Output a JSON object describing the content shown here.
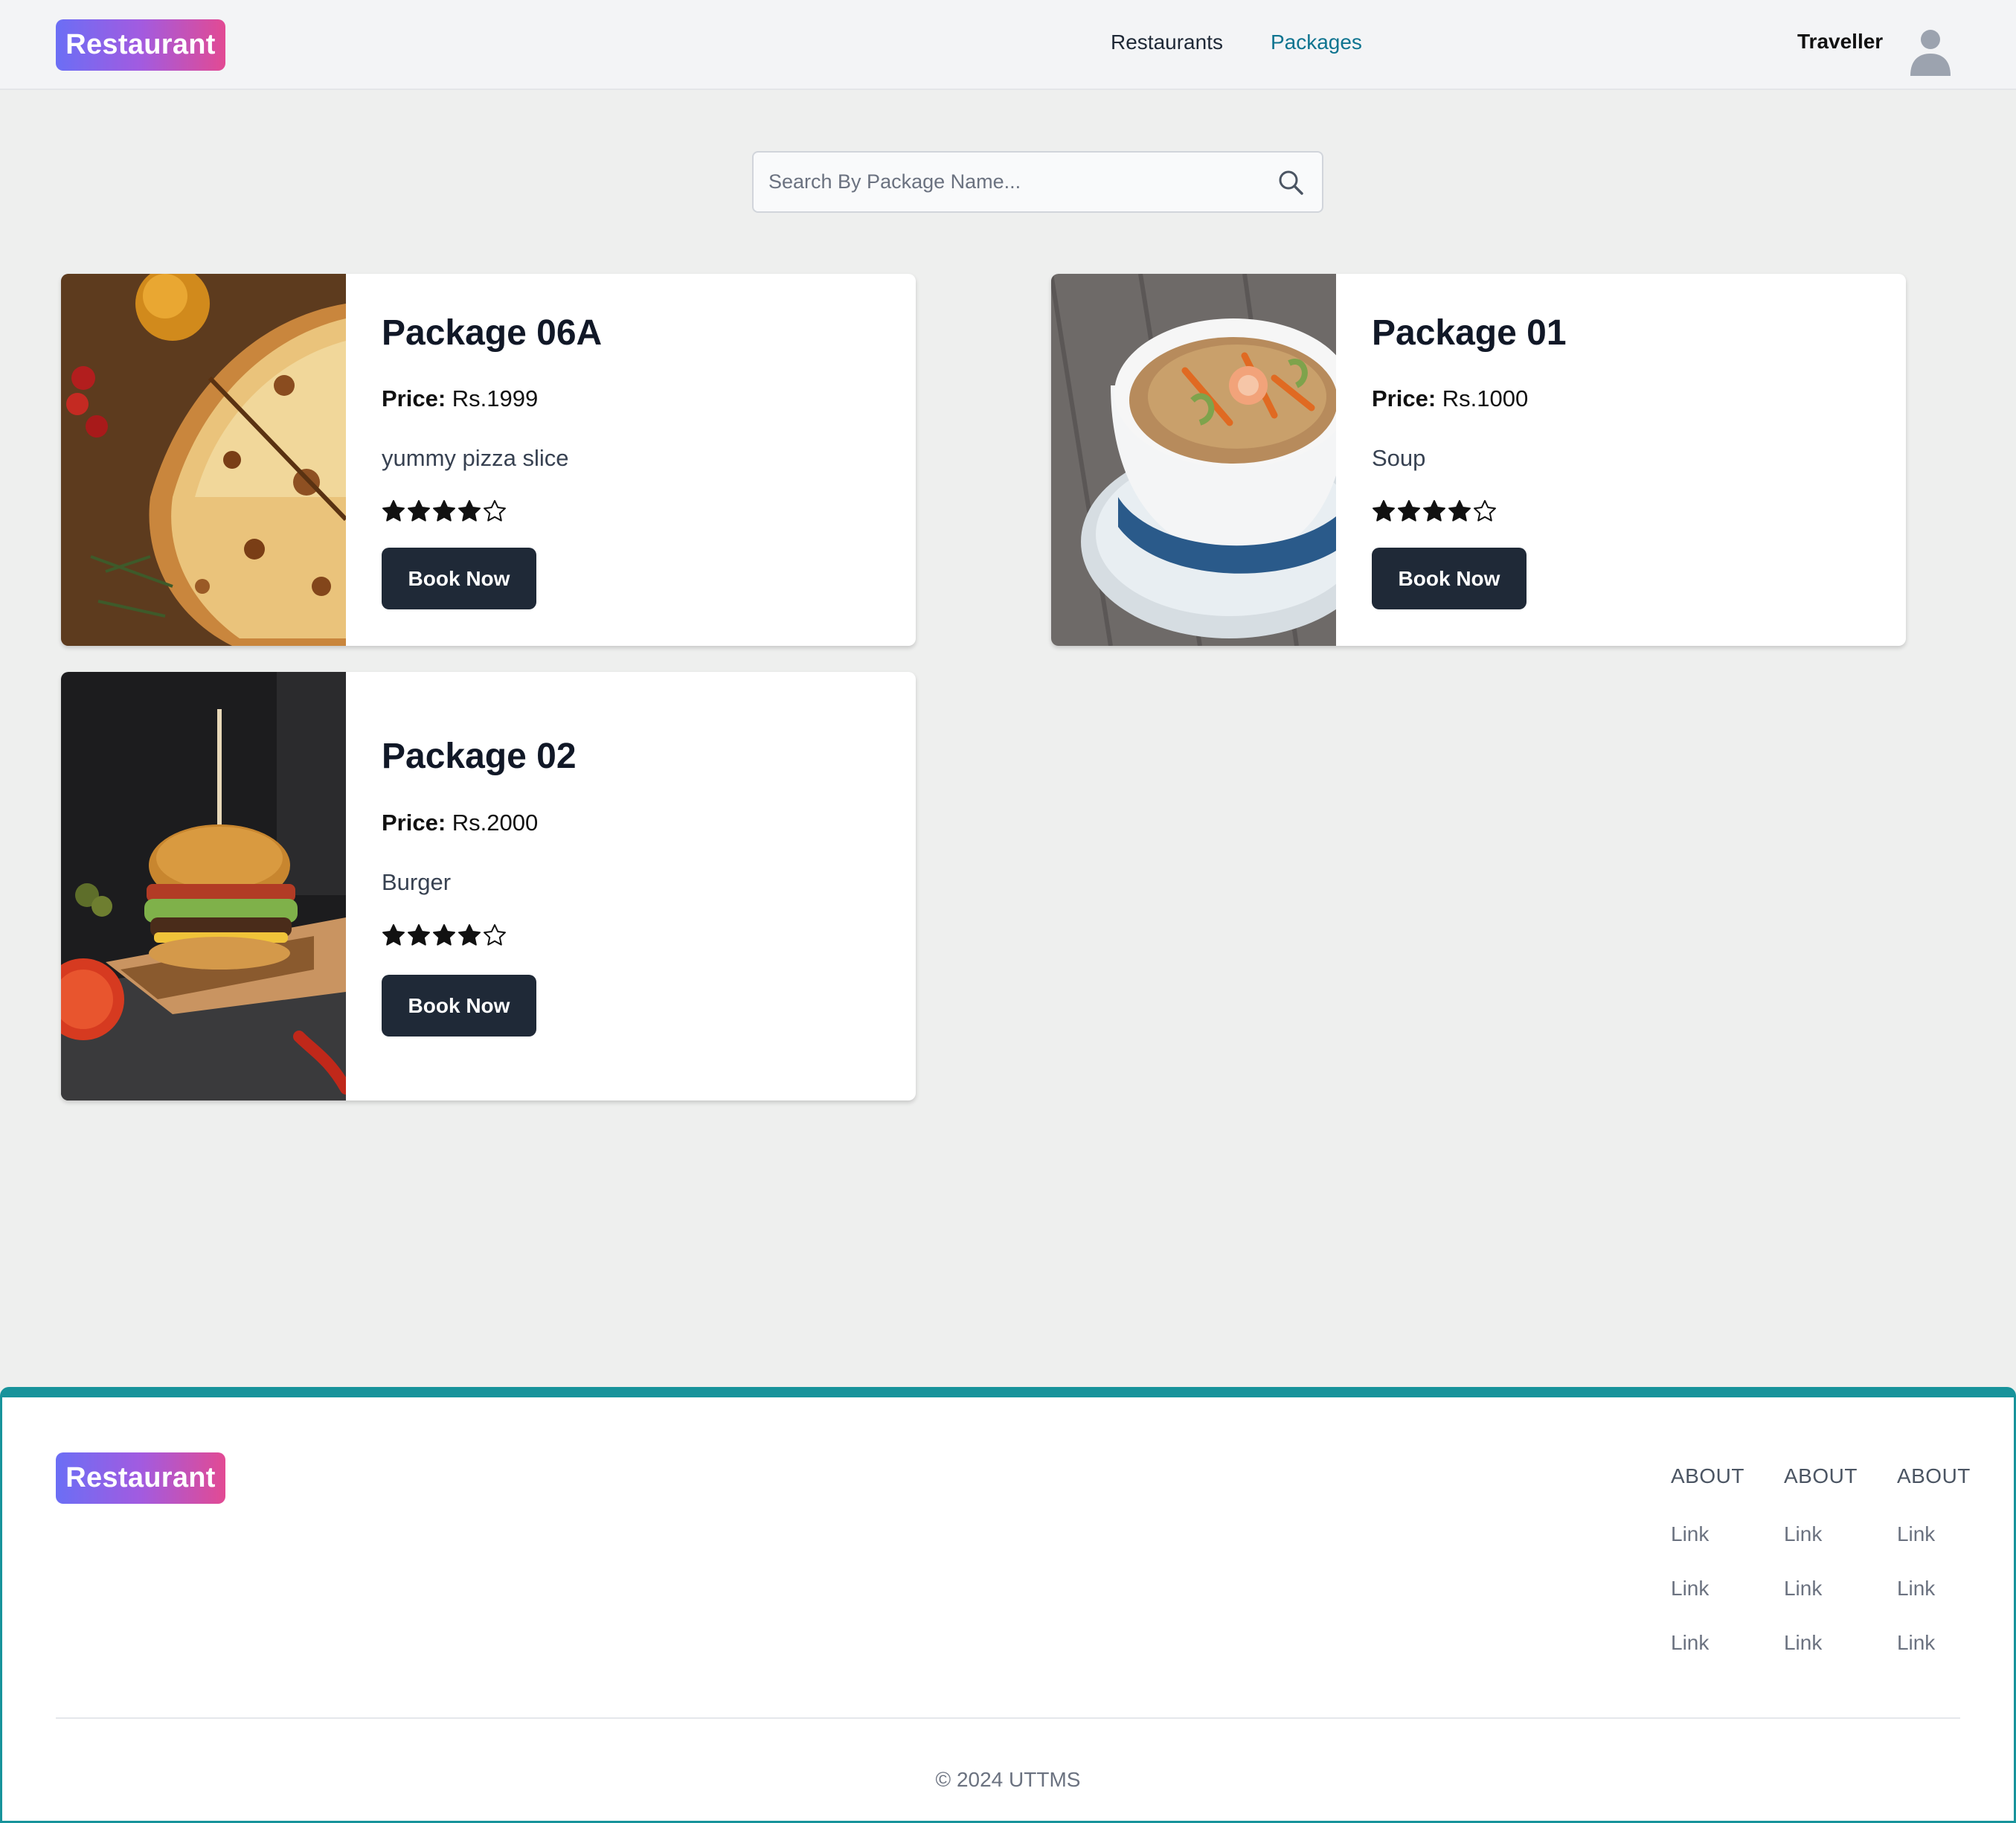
{
  "nav": {
    "brand": "Restaurant",
    "links": [
      {
        "label": "Restaurants",
        "active": false
      },
      {
        "label": "Packages",
        "active": true
      }
    ],
    "user_name": "Traveller"
  },
  "search": {
    "placeholder": "Search By Package Name...",
    "value": ""
  },
  "packages": [
    {
      "title": "Package 06A",
      "price_label": "Price:",
      "price": "Rs.1999",
      "description": "yummy pizza slice",
      "rating": 4,
      "rating_max": 5,
      "button_label": "Book Now",
      "image": "pizza"
    },
    {
      "title": "Package 01",
      "price_label": "Price:",
      "price": "Rs.1000",
      "description": "Soup",
      "rating": 4,
      "rating_max": 5,
      "button_label": "Book Now",
      "image": "soup"
    },
    {
      "title": "Package 02",
      "price_label": "Price:",
      "price": "Rs.2000",
      "description": "Burger",
      "rating": 4,
      "rating_max": 5,
      "button_label": "Book Now",
      "image": "burger"
    }
  ],
  "footer": {
    "brand": "Restaurant",
    "columns": [
      {
        "title": "ABOUT",
        "links": [
          "Link",
          "Link",
          "Link"
        ]
      },
      {
        "title": "ABOUT",
        "links": [
          "Link",
          "Link",
          "Link"
        ]
      },
      {
        "title": "ABOUT",
        "links": [
          "Link",
          "Link",
          "Link"
        ]
      }
    ],
    "copyright": "© 2024 UTTMS"
  },
  "colors": {
    "accent": "#0e7490",
    "button": "#1f2937",
    "footer_border": "#17939b",
    "brand_gradient": [
      "#6b6ef5",
      "#e24a93"
    ]
  }
}
